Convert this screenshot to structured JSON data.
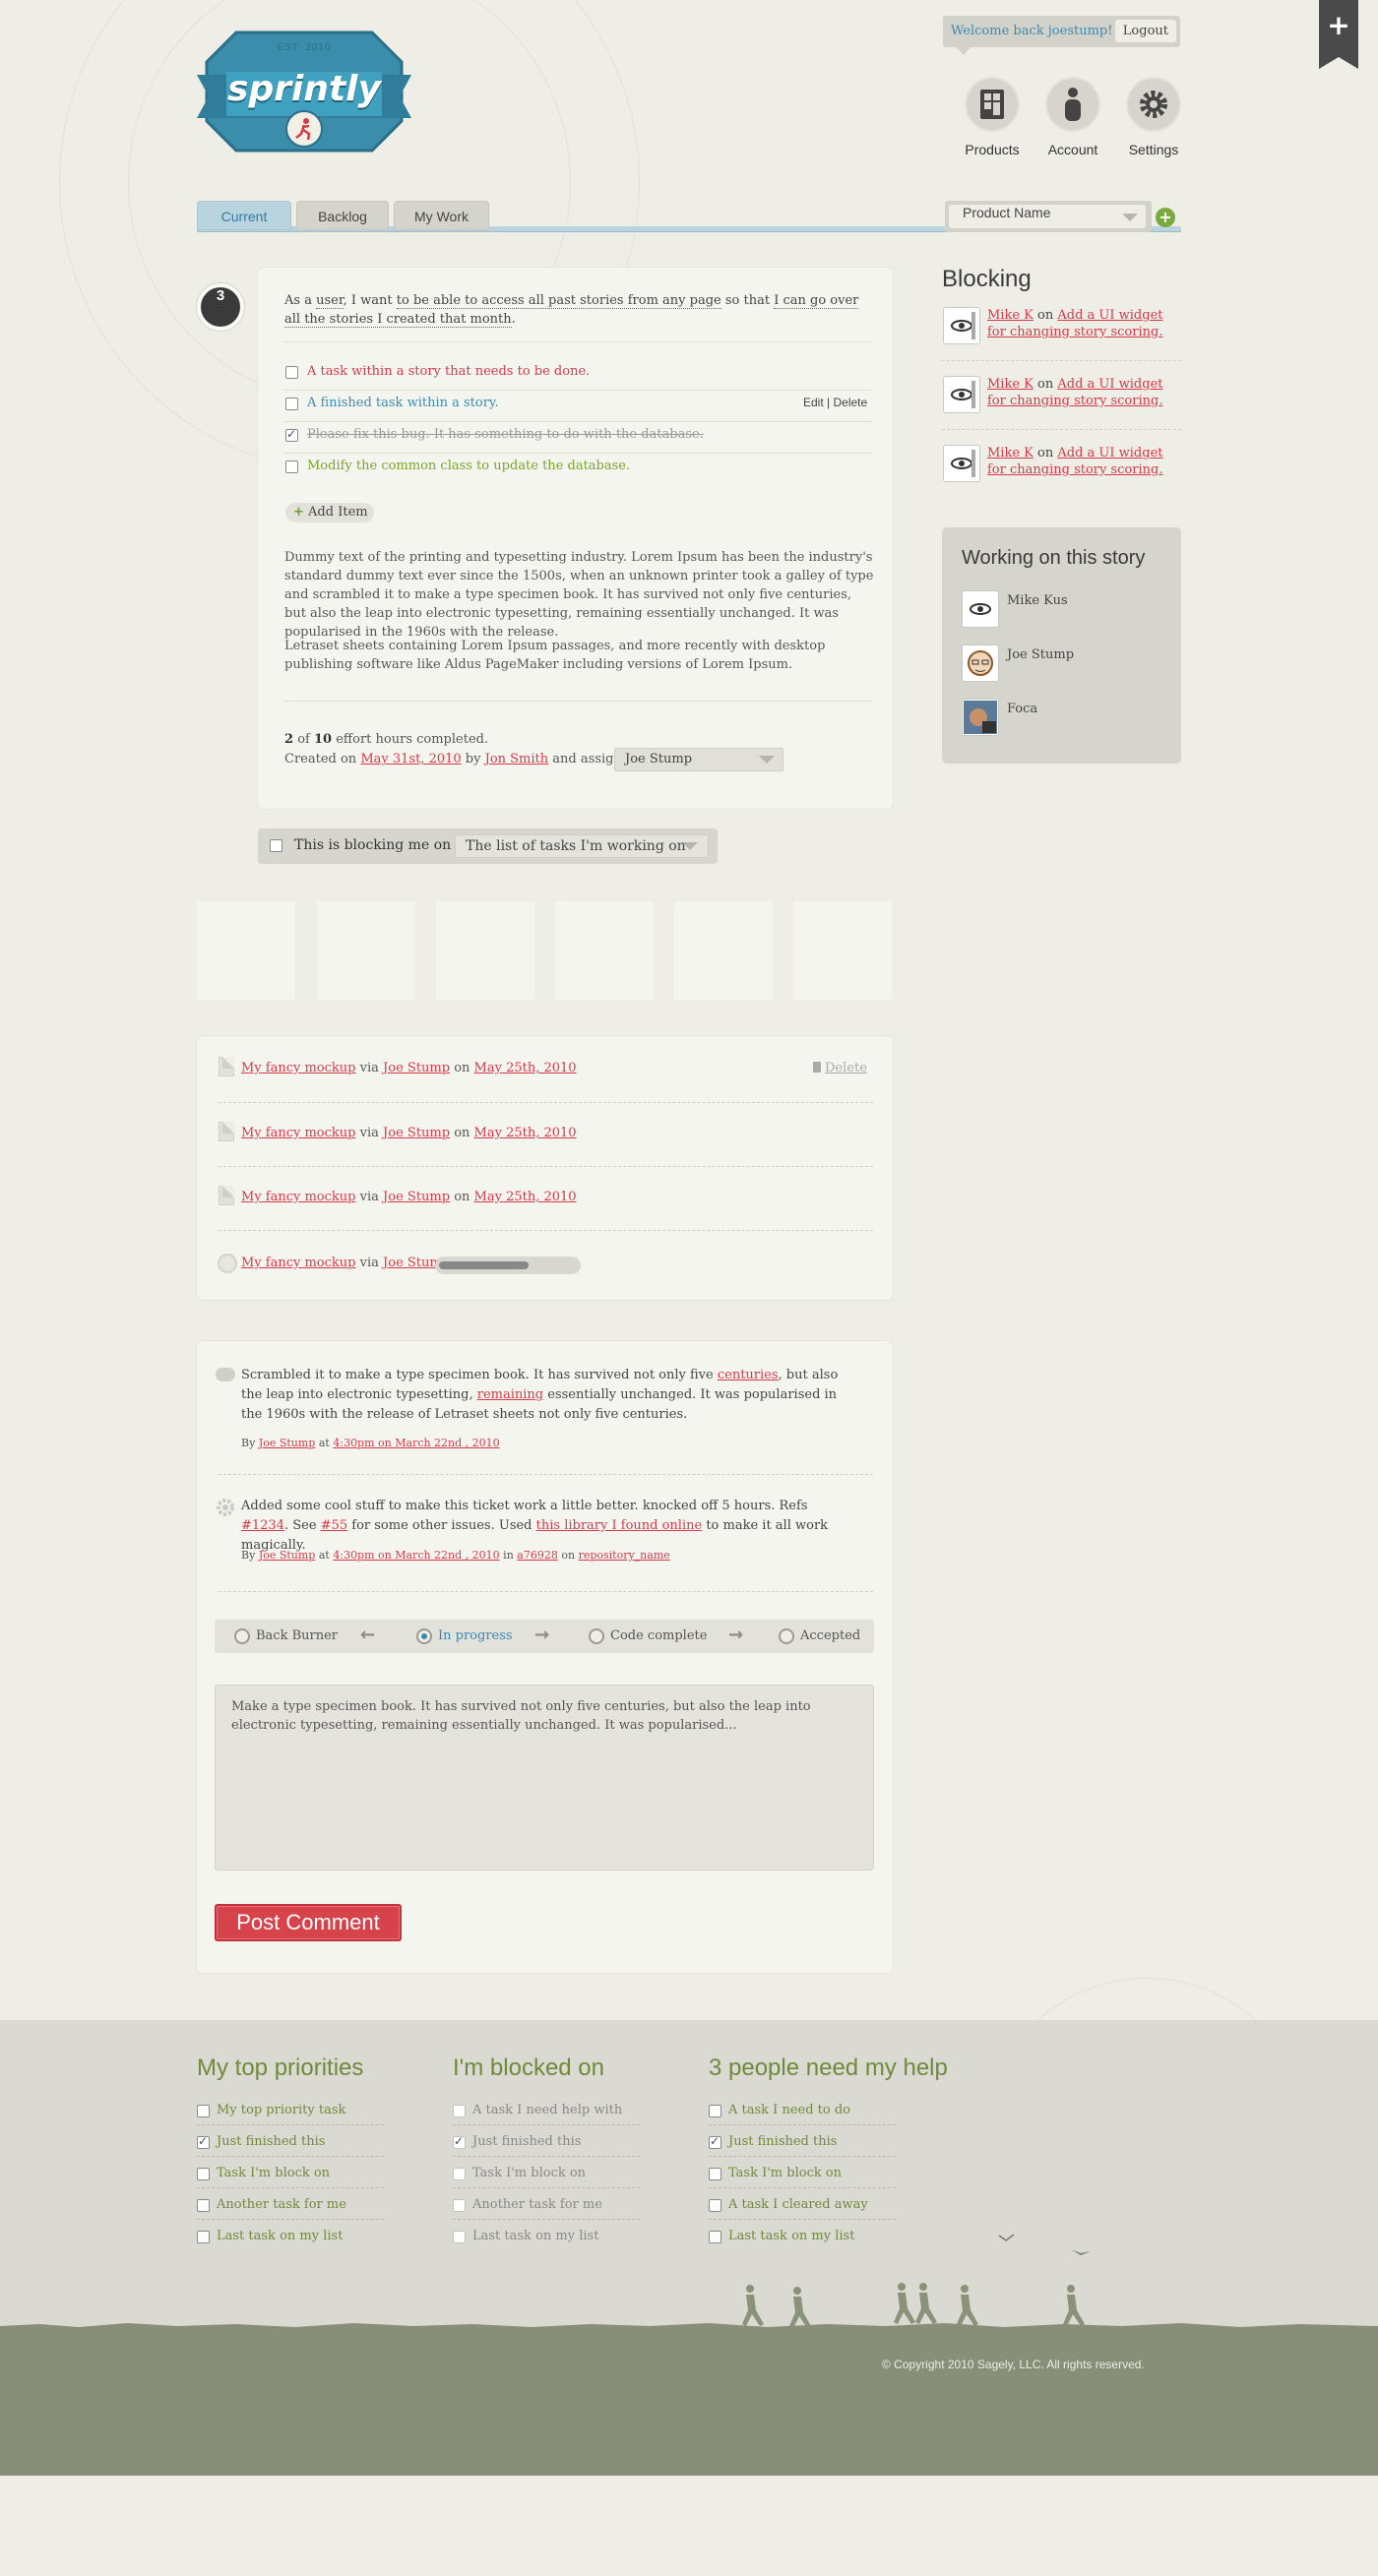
{
  "header": {
    "logo_name": "sprintly",
    "logo_est": "EST. 2010",
    "welcome": "Welcome back joestump!",
    "logout": "Logout",
    "ribbon_icon": "plus-icon",
    "nav": [
      {
        "label": "Products",
        "icon": "products-icon"
      },
      {
        "label": "Account",
        "icon": "account-icon"
      },
      {
        "label": "Settings",
        "icon": "settings-icon"
      }
    ]
  },
  "tabs": [
    "Current",
    "Backlog",
    "My Work"
  ],
  "product_select": "Product Name",
  "story": {
    "number": "3",
    "as_a": "As a",
    "who": "user",
    "i_want": ", I want",
    "what": "to be able to access all past stories from any page",
    "so_that": "so that",
    "why": "I can go over all the stories I created that month",
    "end": "."
  },
  "tasks": [
    {
      "label": "A task within a story that needs to be done.",
      "color": "#d43b4a",
      "checked": false
    },
    {
      "label": "A finished task within a story.",
      "color": "#3e8ab0",
      "checked": false,
      "edit": "Edit",
      "delete": "Delete"
    },
    {
      "label": "Please fix this bug. It has something to do with the database.",
      "color": "#999999",
      "checked": true
    },
    {
      "label": "Modify the common class to update the database.",
      "color": "#7aa42d",
      "checked": false
    }
  ],
  "add_item": "Add Item",
  "description": [
    "Dummy text of the printing and typesetting industry. Lorem Ipsum has been the industry's standard dummy text ever since the 1500s, when an unknown printer took a galley of type and scrambled it to make a type specimen book. It has survived not only five centuries, but also the leap into electronic typesetting, remaining essentially unchanged. It was popularised in the 1960s with the release.",
    "Letraset sheets containing Lorem Ipsum passages, and more recently with desktop publishing software like Aldus PageMaker including versions of Lorem Ipsum."
  ],
  "effort": {
    "done": "2",
    "of": "of",
    "total": "10",
    "suffix": "effort hours completed."
  },
  "created": {
    "prefix": "Created on",
    "date": "May 31st, 2010",
    "by": "by",
    "author": "Jon Smith",
    "assigned": "and assigned to",
    "assignee": "Joe Stump"
  },
  "blocking": {
    "title": "Blocking",
    "items": [
      {
        "user": "Mike K",
        "on": "on",
        "story": "Add a UI widget for changing story scoring."
      },
      {
        "user": "Mike K",
        "on": "on",
        "story": "Add a UI widget for changing story scoring."
      },
      {
        "user": "Mike K",
        "on": "on",
        "story": "Add a UI widget for changing story scoring."
      }
    ]
  },
  "working": {
    "title": "Working on this story",
    "people": [
      "Mike Kus",
      "Joe Stump",
      "Foca"
    ]
  },
  "blocking_me": {
    "label": "This is blocking me on",
    "select": "The list of tasks I'm working on"
  },
  "attachments": [
    {
      "name": "My fancy mockup",
      "via": "via",
      "user": "Joe Stump",
      "on": "on",
      "date": "May 25th, 2010",
      "delete": "Delete"
    },
    {
      "name": "My fancy mockup",
      "via": "via",
      "user": "Joe Stump",
      "on": "on",
      "date": "May 25th, 2010"
    },
    {
      "name": "My fancy mockup",
      "via": "via",
      "user": "Joe Stump",
      "on": "on",
      "date": "May 25th, 2010"
    },
    {
      "name": "My fancy mockup",
      "via": "via",
      "user": "Joe Stump",
      "progress": 0.65
    }
  ],
  "comments": [
    {
      "t1": "Scrambled it to make a type specimen book. It has survived not only five ",
      "l1": "centuries",
      "t2": ", but also the leap into electronic typesetting, ",
      "l2": "remaining",
      "t3": " essentially unchanged. It was popularised in the 1960s with the release of Letraset sheets not only five centuries.",
      "by": "By",
      "user": "Joe Stump",
      "at": "at",
      "time": "4:30pm on March 22nd , 2010"
    },
    {
      "t1": "Added some cool stuff to make this ticket work a little better. knocked off 5 hours. Refs ",
      "l1": "#1234",
      "t2": ". See ",
      "l2": "#55",
      "t3": " for some other issues. Used ",
      "l3": "this library I found online",
      "t4": " to make it all work magically.",
      "by": "By",
      "user": "Joe Stump",
      "at": "at",
      "time": "4:30pm on March 22nd , 2010",
      "in": "in",
      "commit": "a76928",
      "on": "on",
      "repo": "repository_name"
    }
  ],
  "workflow": [
    "Back Burner",
    "In progress",
    "Code complete",
    "Accepted"
  ],
  "comment_box": "Make a type specimen book. It has survived not only five centuries, but also the leap into electronic typesetting, remaining essentially unchanged. It was popularised...",
  "post_comment": "Post Comment",
  "footer": {
    "columns": [
      {
        "title": "My top priorities",
        "items": [
          {
            "label": "My top priority task",
            "checked": false
          },
          {
            "label": "Just finished this",
            "checked": true
          },
          {
            "label": "Task I'm block on",
            "checked": false
          },
          {
            "label": "Another task for me",
            "checked": false
          },
          {
            "label": "Last task on my list",
            "checked": false
          }
        ]
      },
      {
        "title": "I'm blocked on",
        "items": [
          {
            "label": "A task I need help with",
            "checked": false
          },
          {
            "label": "Just finished this",
            "checked": true
          },
          {
            "label": "Task I'm block on",
            "checked": false
          },
          {
            "label": "Another task for me",
            "checked": false
          },
          {
            "label": "Last task on my list",
            "checked": false
          }
        ]
      },
      {
        "title": "3 people need my help",
        "items": [
          {
            "label": "A task I need to do",
            "checked": false
          },
          {
            "label": "Just finished this",
            "checked": true
          },
          {
            "label": "Task I'm block on",
            "checked": false
          },
          {
            "label": "A task I cleared away",
            "checked": false
          },
          {
            "label": "Last task on my list",
            "checked": false
          }
        ]
      }
    ],
    "copyright": "© Copyright 2010 Sagely, LLC. All rights reserved."
  }
}
